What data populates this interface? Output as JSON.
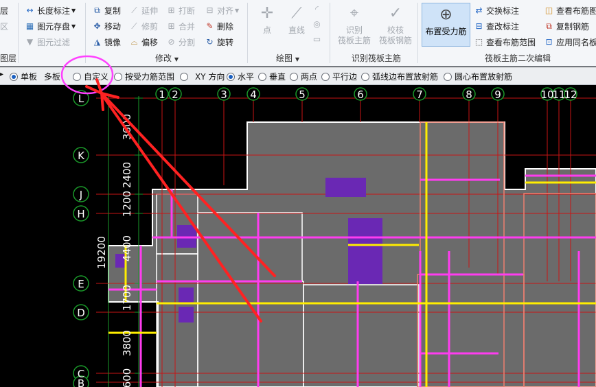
{
  "ribbon": {
    "layer_group": {
      "item1": "层",
      "item2": "区",
      "footer": "图层"
    },
    "measure_group": {
      "length_label": "长度标注",
      "save_label": "图元存盘",
      "filter_label": "图元过滤"
    },
    "modify_group": {
      "copy": "复制",
      "extend": "延伸",
      "break": "打断",
      "align": "对齐",
      "move": "移动",
      "trim": "修剪",
      "merge": "合并",
      "delete": "删除",
      "mirror": "镜像",
      "offset": "偏移",
      "split": "分割",
      "rotate": "旋转",
      "footer": "修改"
    },
    "draw_group": {
      "point": "点",
      "line": "直线",
      "footer": "绘图"
    },
    "identify_group": {
      "identify": "识别\n筏板主筋",
      "check": "校核\n筏板钢筋",
      "footer": "识别筏板主筋"
    },
    "edit_group": {
      "place": "布置受力筋",
      "swap_label": "交换标注",
      "edit_label": "查改标注",
      "view_range": "查看布筋范围",
      "view_plan": "查看布筋图",
      "copy_rebar": "复制钢筋",
      "apply_same": "应用同名板",
      "footer": "筏板主筋二次编辑"
    }
  },
  "options": {
    "single": "单板",
    "multi": "多板",
    "custom": "自定义",
    "by_range": "按受力筋范围",
    "xy": "XY 方向",
    "horizontal": "水平",
    "vertical": "垂直",
    "two_point": "两点",
    "parallel": "平行边",
    "arc_radial": "弧线边布置放射筋",
    "center_radial": "圆心布置放射筋"
  },
  "axes": {
    "columns": [
      "1",
      "2",
      "3",
      "4",
      "5",
      "6",
      "7",
      "8",
      "9",
      "10",
      "11",
      "12"
    ],
    "rows": [
      "L",
      "K",
      "J",
      "H",
      "E",
      "D",
      "C",
      "B"
    ],
    "dims": [
      "3600",
      "2400",
      "1200",
      "4400",
      "1700",
      "3800",
      "600"
    ],
    "total": "19200"
  },
  "colors": {
    "slab": "#6b6b6b",
    "grid": "#c81414",
    "rebar_magenta": "#ff3cf0",
    "rebar_yellow": "#ffee00",
    "column": "#6a28b4",
    "annotation": "#ff2222",
    "highlight": "#ff40ff"
  }
}
